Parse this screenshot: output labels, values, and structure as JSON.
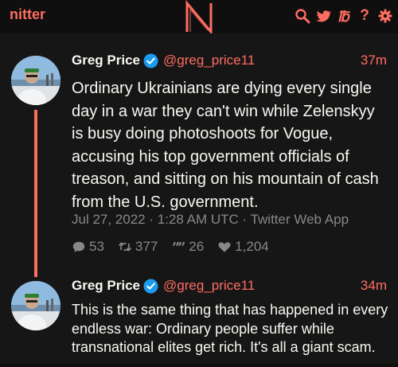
{
  "navbar": {
    "brand": "nitter",
    "icons": [
      "search-icon",
      "twitter-bird-icon",
      "rss-icon",
      "help-icon",
      "settings-icon"
    ]
  },
  "tweets": [
    {
      "fullname": "Greg Price",
      "username": "@greg_price11",
      "time": "37m",
      "content": "Ordinary Ukrainians are dying every single day in a war they can't win while Zelenskyy is busy doing photoshoots for Vogue, accusing his top government officials of treason, and sitting on his mountain of cash from the U.S. government.",
      "published": "Jul 27, 2022 · 1:28 AM UTC · Twitter Web App",
      "stats": {
        "replies": "53",
        "retweets": "377",
        "quotes": "26",
        "likes": "1,204"
      }
    },
    {
      "fullname": "Greg Price",
      "username": "@greg_price11",
      "time": "34m",
      "content": "This is the same thing that has happened in every endless war: Ordinary people suffer while transnational elites get rich. It's all a giant scam."
    }
  ],
  "colors": {
    "accent": "#ff6c60",
    "background": "#161616",
    "navbar": "#0f0f0f",
    "text": "#f8f8f2",
    "muted": "#888889",
    "verified": "#1d9bf0"
  }
}
